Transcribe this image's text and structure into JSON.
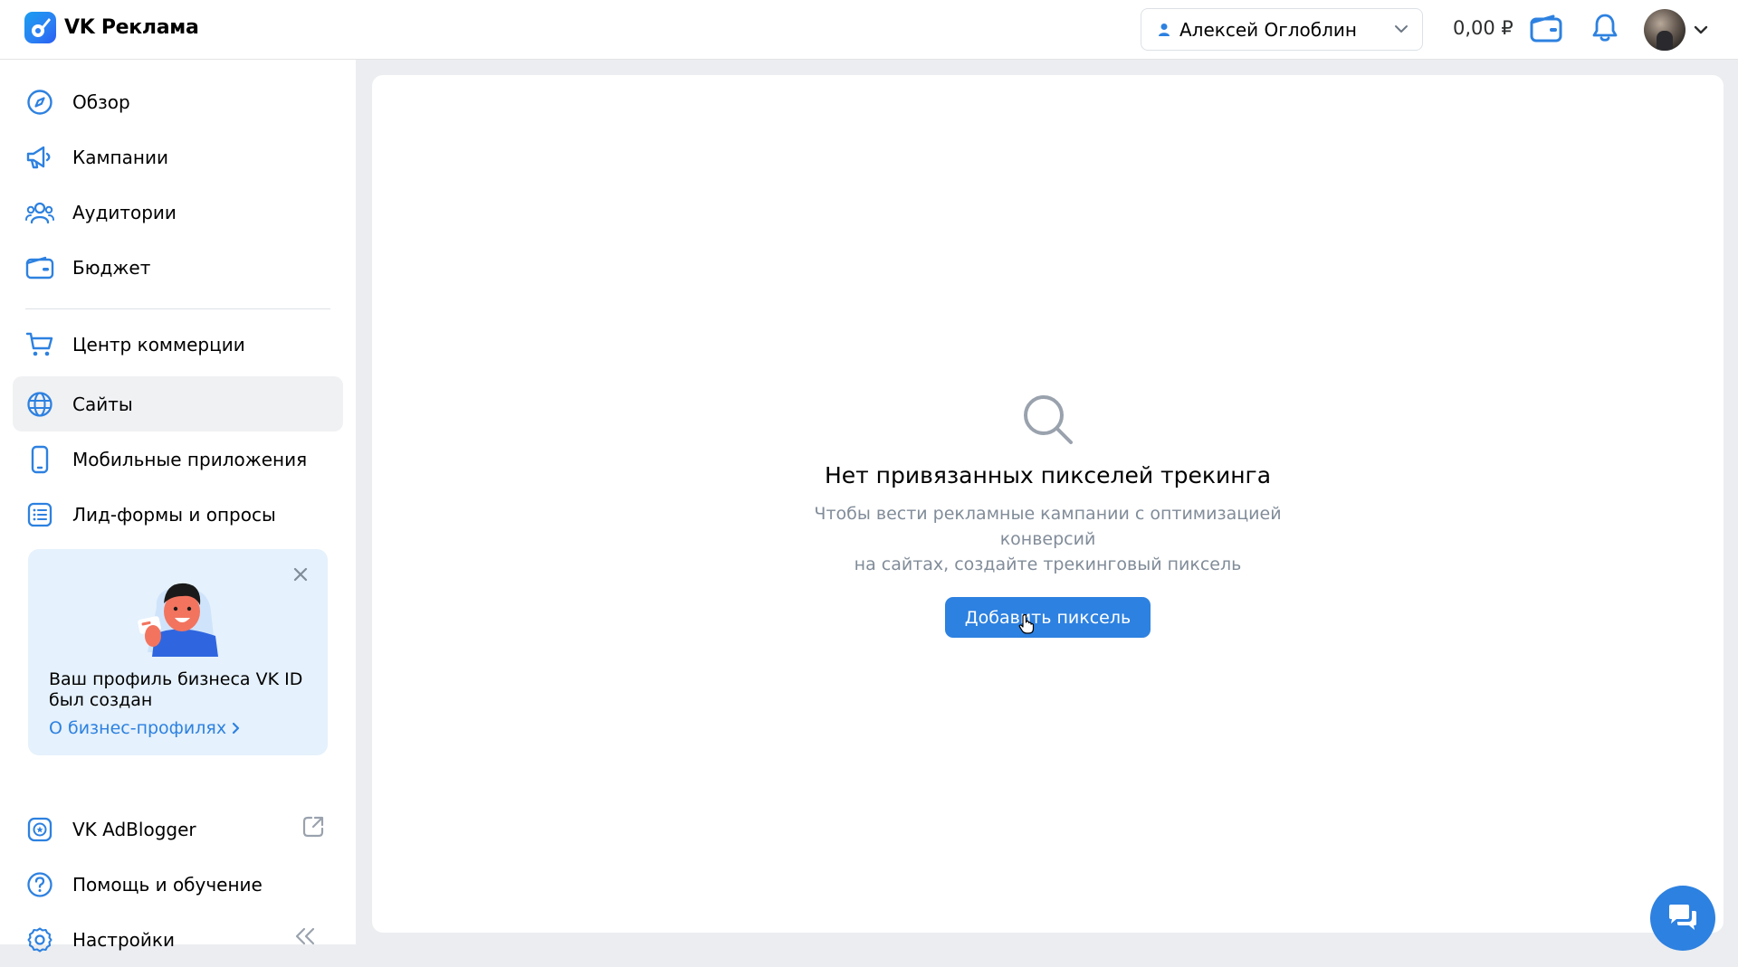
{
  "header": {
    "brand": "VK Реклама",
    "account_name": "Алексей Оглоблин",
    "balance": "0,00 ₽"
  },
  "sidebar": {
    "items": [
      {
        "label": "Обзор",
        "icon": "compass-icon"
      },
      {
        "label": "Кампании",
        "icon": "megaphone-icon"
      },
      {
        "label": "Аудитории",
        "icon": "users-icon"
      },
      {
        "label": "Бюджет",
        "icon": "wallet-icon"
      },
      {
        "label": "Центр коммерции",
        "icon": "cart-icon"
      },
      {
        "label": "Сайты",
        "icon": "globe-icon",
        "active": true
      },
      {
        "label": "Мобильные приложения",
        "icon": "phone-icon"
      },
      {
        "label": "Лид-формы и опросы",
        "icon": "list-icon"
      }
    ],
    "promo": {
      "title": "Ваш профиль бизнеса VK ID был создан",
      "link": "О бизнес-профилях"
    },
    "bottom_items": [
      {
        "label": "VK AdBlogger",
        "icon": "adblogger-icon"
      },
      {
        "label": "Помощь и обучение",
        "icon": "help-icon"
      },
      {
        "label": "Настройки",
        "icon": "gear-icon"
      }
    ]
  },
  "main": {
    "empty_title": "Нет привязанных пикселей трекинга",
    "empty_desc_line1": "Чтобы вести рекламные кампании с оптимизацией конверсий",
    "empty_desc_line2": "на сайтах, создайте трекинговый пиксель",
    "add_button": "Добавить пиксель"
  },
  "colors": {
    "accent": "#2d81e0",
    "icon_blue": "#2d81e0",
    "muted_text": "#818c99",
    "promo_bg": "#e5f1fc",
    "active_bg": "#f0f1f3"
  }
}
